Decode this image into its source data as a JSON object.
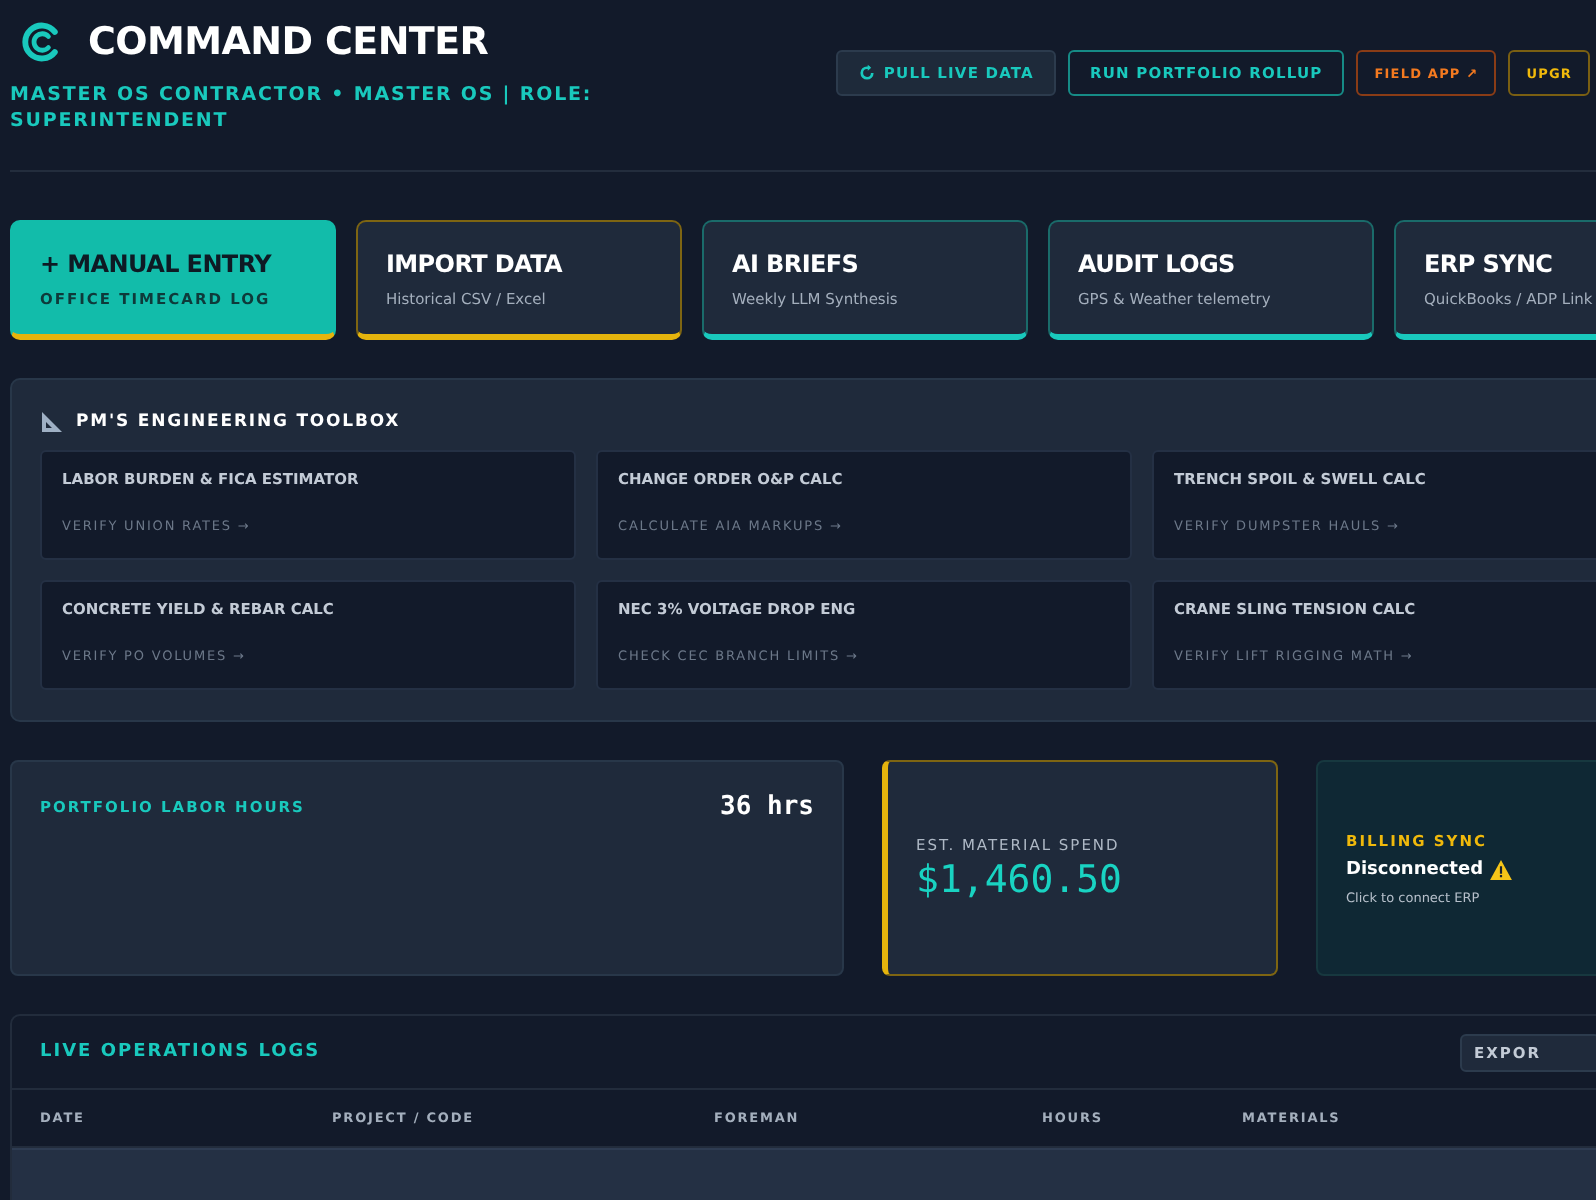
{
  "header": {
    "title": "COMMAND CENTER",
    "subtitle": "MASTER OS CONTRACTOR • MASTER OS | ROLE: SUPERINTENDENT",
    "buttons": [
      {
        "label": "PULL LIVE DATA",
        "kind": "refresh"
      },
      {
        "label": "RUN PORTFOLIO ROLLUP",
        "kind": "primary"
      },
      {
        "label": "FIELD APP ↗",
        "kind": "field"
      },
      {
        "label": "UPGR",
        "kind": "upgrade"
      }
    ]
  },
  "actions": [
    {
      "title": "+ MANUAL ENTRY",
      "subtitle": "OFFICE TIMECARD LOG",
      "kind": "primary"
    },
    {
      "title": "IMPORT DATA",
      "subtitle": "Historical CSV / Excel",
      "kind": "gold"
    },
    {
      "title": "AI BRIEFS",
      "subtitle": "Weekly LLM Synthesis",
      "kind": "teal"
    },
    {
      "title": "AUDIT LOGS",
      "subtitle": "GPS & Weather telemetry",
      "kind": "teal"
    },
    {
      "title": "ERP SYNC",
      "subtitle": "QuickBooks / ADP Link",
      "kind": "teal"
    }
  ],
  "toolbox": {
    "title": "PM'S ENGINEERING TOOLBOX",
    "tools": [
      {
        "title": "LABOR BURDEN & FICA ESTIMATOR",
        "link": "VERIFY UNION RATES →"
      },
      {
        "title": "CHANGE ORDER O&P CALC",
        "link": "CALCULATE AIA MARKUPS →"
      },
      {
        "title": "TRENCH SPOIL & SWELL CALC",
        "link": "VERIFY DUMPSTER HAULS →"
      },
      {
        "title": "CONCRETE YIELD & REBAR CALC",
        "link": "VERIFY PO VOLUMES →"
      },
      {
        "title": "NEC 3% VOLTAGE DROP ENG",
        "link": "CHECK CEC BRANCH LIMITS →"
      },
      {
        "title": "CRANE SLING TENSION CALC",
        "link": "VERIFY LIFT RIGGING MATH →"
      }
    ]
  },
  "stats": {
    "labor": {
      "label": "PORTFOLIO LABOR HOURS",
      "value": "36 hrs"
    },
    "material": {
      "label": "EST. MATERIAL SPEND",
      "value": "$1,460.50"
    },
    "billing": {
      "label": "BILLING SYNC",
      "status": "Disconnected",
      "note": "Click to connect ERP"
    }
  },
  "logs": {
    "title": "LIVE OPERATIONS LOGS",
    "export": "EXPOR",
    "columns": [
      "DATE",
      "PROJECT / CODE",
      "FOREMAN",
      "HOURS",
      "MATERIALS"
    ]
  }
}
